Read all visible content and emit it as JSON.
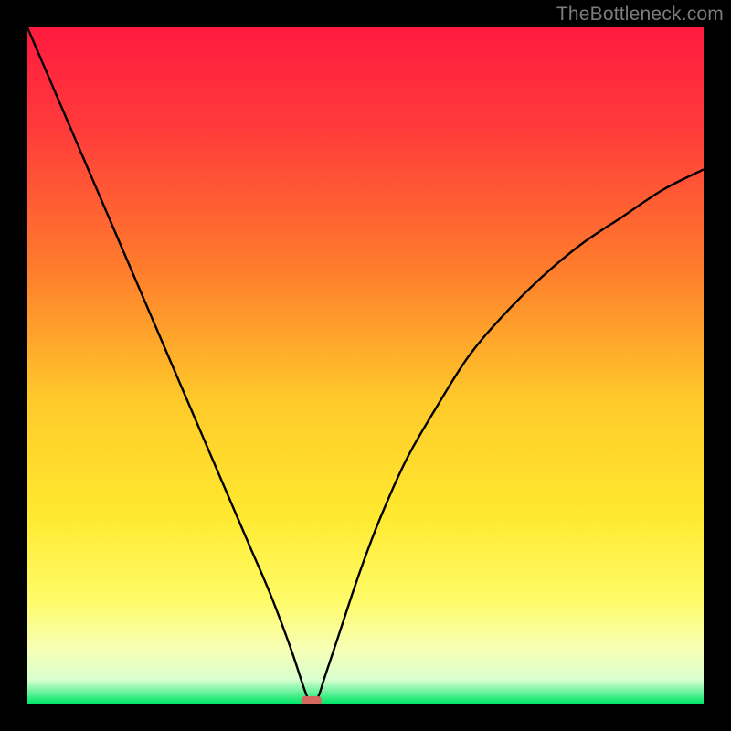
{
  "attribution": "TheBottleneck.com",
  "colors": {
    "background": "#000000",
    "curve": "#000000",
    "marker": "#d46a5f",
    "gradient_stops": [
      {
        "offset": 0,
        "color": "#ff1a3f"
      },
      {
        "offset": 0.15,
        "color": "#ff3b3b"
      },
      {
        "offset": 0.35,
        "color": "#ff7a2c"
      },
      {
        "offset": 0.55,
        "color": "#ffc92a"
      },
      {
        "offset": 0.72,
        "color": "#ffe92f"
      },
      {
        "offset": 0.85,
        "color": "#fffc6a"
      },
      {
        "offset": 0.92,
        "color": "#f6ffb5"
      },
      {
        "offset": 0.965,
        "color": "#d9ffd0"
      },
      {
        "offset": 1.0,
        "color": "#00e66a"
      }
    ]
  },
  "chart_data": {
    "type": "line",
    "title": "",
    "xlabel": "",
    "ylabel": "",
    "xlim": [
      0,
      1
    ],
    "ylim": [
      0,
      1
    ],
    "grid": false,
    "legend": false,
    "series": [
      {
        "name": "curve",
        "x": [
          0.0,
          0.03,
          0.06,
          0.09,
          0.12,
          0.15,
          0.18,
          0.21,
          0.24,
          0.27,
          0.3,
          0.33,
          0.36,
          0.39,
          0.41,
          0.42,
          0.43,
          0.44,
          0.46,
          0.49,
          0.52,
          0.56,
          0.6,
          0.65,
          0.7,
          0.76,
          0.82,
          0.88,
          0.94,
          1.0
        ],
        "values": [
          1.0,
          0.93,
          0.86,
          0.79,
          0.72,
          0.65,
          0.58,
          0.51,
          0.44,
          0.37,
          0.3,
          0.23,
          0.16,
          0.08,
          0.02,
          0.0,
          0.01,
          0.04,
          0.1,
          0.19,
          0.27,
          0.36,
          0.43,
          0.51,
          0.57,
          0.63,
          0.68,
          0.72,
          0.76,
          0.79
        ]
      }
    ],
    "marker": {
      "x": 0.42,
      "y": 0.0
    }
  }
}
